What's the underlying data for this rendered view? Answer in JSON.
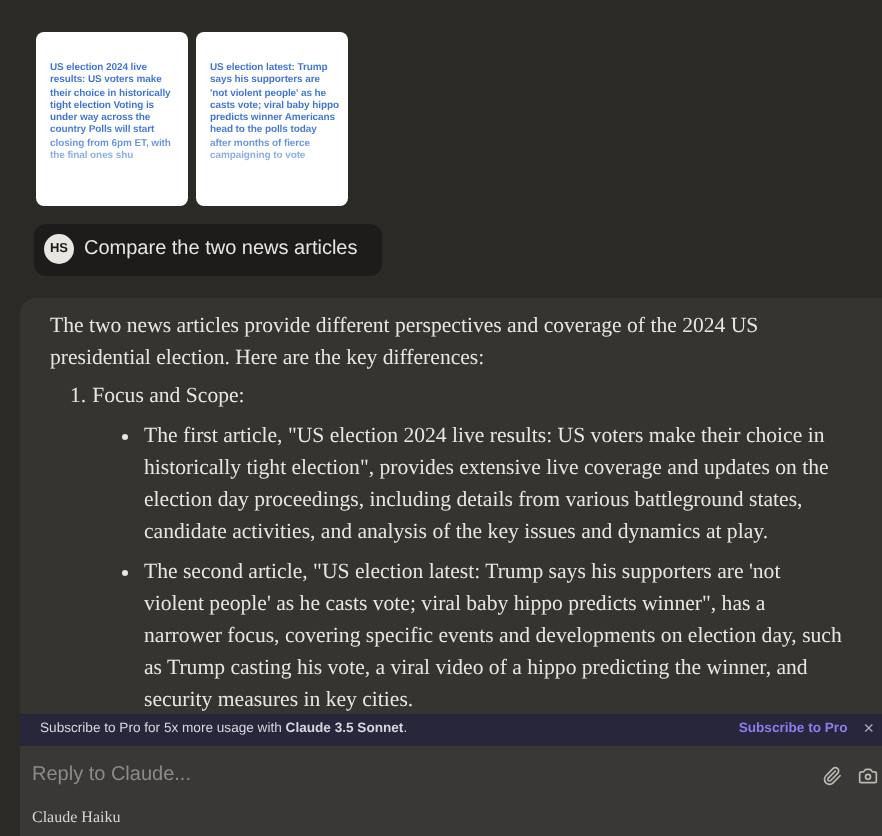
{
  "attachments": [
    {
      "text": "US election 2024 live results: US voters make their choice in historically tight election Voting is under way across the country Polls will start closing from 6pm ET, with the final ones shu"
    },
    {
      "text": "US election latest: Trump says his supporters are 'not violent people' as he casts vote; viral baby hippo predicts winner Americans head to the polls today after months of fierce campaigning to vote"
    }
  ],
  "user_message": {
    "initials": "HS",
    "text": "Compare the two news articles"
  },
  "response": {
    "intro": "The two news articles provide different perspectives and coverage of the 2024 US presidential election. Here are the key differences:",
    "items": [
      {
        "number": "1.",
        "title": "Focus and Scope:",
        "bullets": [
          "The first article, \"US election 2024 live results: US voters make their choice in historically tight election\", provides extensive live coverage and updates on the election day proceedings, including details from various battleground states, candidate activities, and analysis of the key issues and dynamics at play.",
          "The second article, \"US election latest: Trump says his supporters are 'not violent people' as he casts vote; viral baby hippo predicts winner\", has a narrower focus, covering specific events and developments on election day, such as Trump casting his vote, a viral video of a hippo predicting the winner, and security measures in key cities."
        ]
      }
    ]
  },
  "banner": {
    "text": "Subscribe to Pro for 5x more usage with **Claude 3.5 Sonnet**.",
    "link": "Subscribe to Pro",
    "close": "×"
  },
  "composer": {
    "placeholder": "Reply to Claude...",
    "model": "Claude Haiku"
  }
}
